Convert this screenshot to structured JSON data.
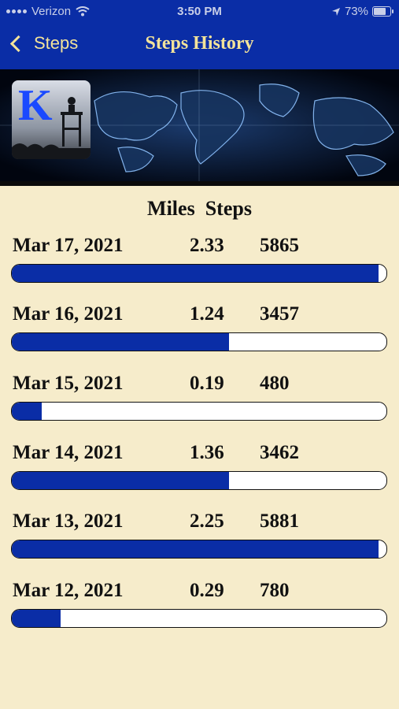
{
  "status_bar": {
    "carrier": "Verizon",
    "time": "3:50 PM",
    "battery": "73%"
  },
  "nav": {
    "back_label": "Steps",
    "title": "Steps History"
  },
  "logo": {
    "letter": "K"
  },
  "columns": {
    "miles": "Miles",
    "steps": "Steps"
  },
  "colors": {
    "accent": "#0a2da6",
    "title": "#f3e39a",
    "background": "#f6eccb"
  },
  "history": [
    {
      "date": "Mar 17, 2021",
      "miles": "2.33",
      "steps": "5865",
      "progress": 0.98
    },
    {
      "date": "Mar 16, 2021",
      "miles": "1.24",
      "steps": "3457",
      "progress": 0.58
    },
    {
      "date": "Mar 15, 2021",
      "miles": "0.19",
      "steps": "480",
      "progress": 0.08
    },
    {
      "date": "Mar 14, 2021",
      "miles": "1.36",
      "steps": "3462",
      "progress": 0.58
    },
    {
      "date": "Mar 13, 2021",
      "miles": "2.25",
      "steps": "5881",
      "progress": 0.98
    },
    {
      "date": "Mar 12, 2021",
      "miles": "0.29",
      "steps": "780",
      "progress": 0.13
    }
  ]
}
